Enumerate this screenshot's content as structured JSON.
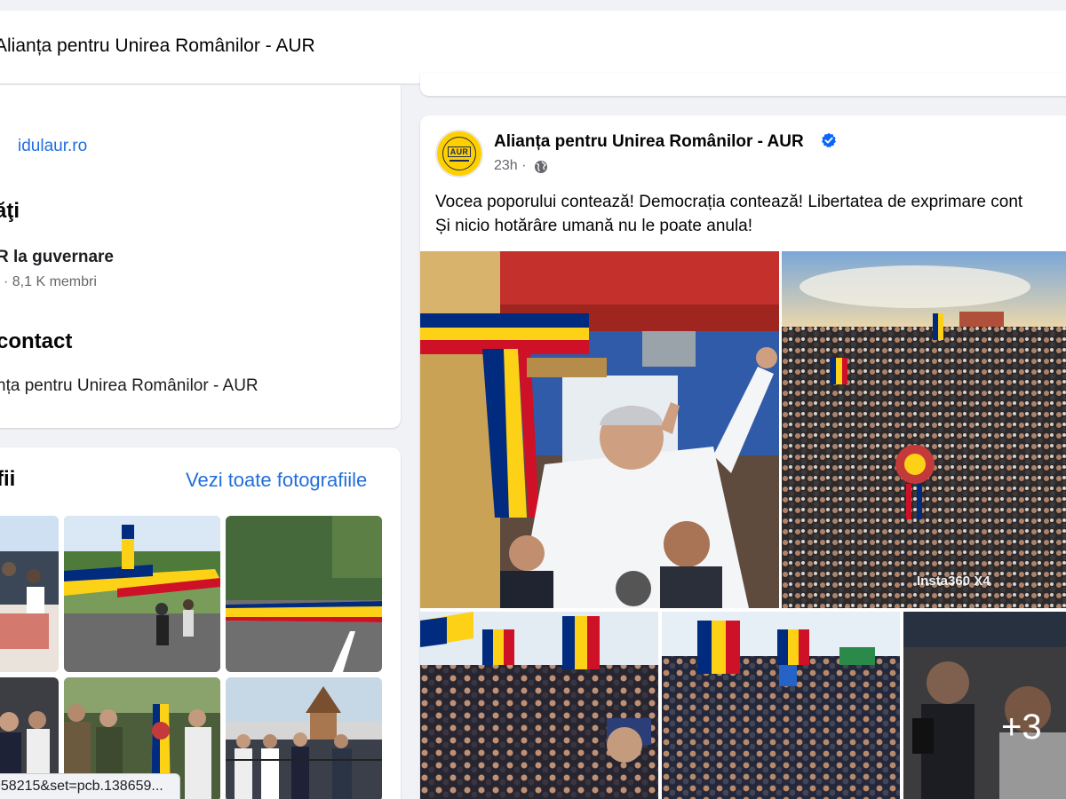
{
  "page": {
    "title": "Alianța pentru Unirea Românilor - AUR"
  },
  "intro": {
    "website": "idulaur.ro",
    "groups_heading": "ăţi",
    "group_name": "R la guvernare",
    "group_meta": "l · 8,1 K membri",
    "contact_heading": "contact",
    "contact_name": "nța pentru Unirea Românilor - AUR"
  },
  "photos": {
    "heading": "fii",
    "see_all": "Vezi toate fotografiile"
  },
  "post": {
    "author": "Alianța pentru Unirea Românilor - AUR",
    "avatar_logo": "AUR",
    "verified": true,
    "time": "23h ·",
    "privacy_icon": "globe-icon",
    "text_line1": "Vocea poporului contează! Democrația contează! Libertatea de exprimare cont",
    "text_line2": "Și nicio hotărâre umană nu le poate anula!",
    "photo_watermark": "Insta360 X4",
    "more_photos": "+3"
  },
  "status_bar": {
    "url": "958215&set=pcb.138659..."
  },
  "colors": {
    "link": "#216fdb",
    "verified": "#0866ff",
    "aur_yellow": "#ffd000",
    "flag_blue": "#002b7f",
    "flag_yellow": "#fcd116",
    "flag_red": "#ce1126"
  }
}
